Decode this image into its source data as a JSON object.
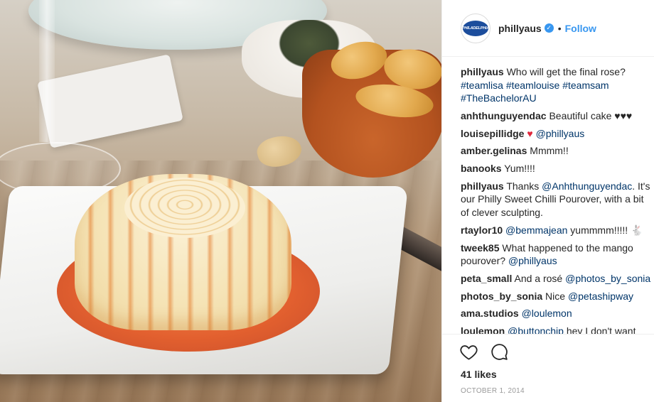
{
  "header": {
    "avatar_text": "PHILADELPHIA",
    "username": "phillyaus",
    "separator": "•",
    "follow_label": "Follow"
  },
  "comments": [
    {
      "user": "phillyaus",
      "text": "Who will get the final rose? #teamlisa #teamlouise #teamsam #TheBachelorAU"
    },
    {
      "user": "anhthunguyendac",
      "text": "Beautiful cake ♥♥♥"
    },
    {
      "user": "louisepillidge",
      "heart": "♥",
      "mention": "@phillyaus"
    },
    {
      "user": "amber.gelinas",
      "text": "Mmmm!!"
    },
    {
      "user": "banooks",
      "text": "Yum!!!!"
    },
    {
      "user": "phillyaus",
      "pre": "Thanks",
      "mention": "@Anhthunguyendac",
      "post": ". It's our Philly Sweet Chilli Pourover, with a bit of clever sculpting."
    },
    {
      "user": "rtaylor10",
      "mention": "@bemmajean",
      "post": " yummmm!!!!! 🐇"
    },
    {
      "user": "tweek85",
      "pre": "What happened to the mango pourover?",
      "mention": "@phillyaus"
    },
    {
      "user": "peta_small",
      "pre": "And a rosé",
      "mention": "@photos_by_sonia"
    },
    {
      "user": "photos_by_sonia",
      "pre": "Nice",
      "mention": "@petashipway"
    },
    {
      "user": "ama.studios",
      "mention": "@loulemon"
    },
    {
      "user": "loulemon",
      "mention": "@buttonchip",
      "post": " hey I don't want"
    }
  ],
  "likes": "41 likes",
  "date": "OCTOBER 1, 2014",
  "colors": {
    "link": "#003569",
    "follow": "#3897f0",
    "heart": "#e0263a"
  }
}
